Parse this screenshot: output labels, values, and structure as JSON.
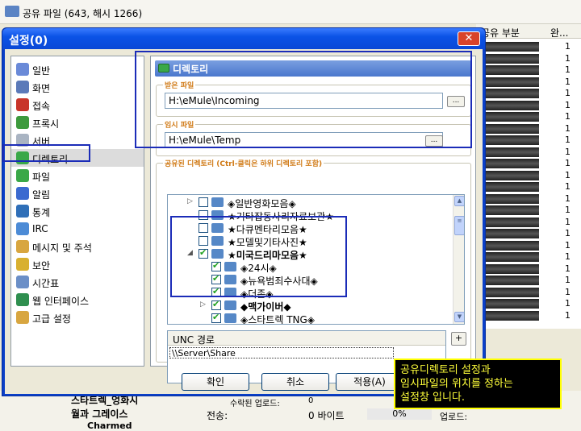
{
  "app": {
    "title": "공유 파일 (643, 해시 1266)",
    "columns": [
      "공유 부분",
      "완..."
    ],
    "list_values": [
      "1",
      "1",
      "1",
      "1",
      "1",
      "1",
      "1",
      "1",
      "1",
      "1",
      "1",
      "1",
      "1",
      "1",
      "1",
      "1",
      "1",
      "1",
      "1",
      "1",
      "1",
      "1",
      "1",
      "1"
    ],
    "bottom_tree": [
      "스타트렉_엉화시",
      "월과 그레이스",
      "Charmed"
    ],
    "stats": {
      "uploaded_label": "수락된 업로드:",
      "uploaded_value": "0",
      "transfer_label": "전송:",
      "transfer_value": "0 바이트",
      "percent": "0%",
      "upload_label": "업로드:"
    }
  },
  "dialog": {
    "title": "설정(0)",
    "close_label": "✕",
    "nav": [
      {
        "label": "일반",
        "icon": "general-icon",
        "color": "#6a8ad8"
      },
      {
        "label": "화면",
        "icon": "display-icon",
        "color": "#5b7ab9"
      },
      {
        "label": "접속",
        "icon": "connection-icon",
        "color": "#c8352a"
      },
      {
        "label": "프록시",
        "icon": "proxy-icon",
        "color": "#3d9a3d"
      },
      {
        "label": "서버",
        "icon": "server-icon",
        "color": "#a9b4c2"
      },
      {
        "label": "디렉토리",
        "icon": "directory-icon",
        "color": "#3aa848"
      },
      {
        "label": "파일",
        "icon": "file-icon",
        "color": "#3aa848"
      },
      {
        "label": "알림",
        "icon": "notification-icon",
        "color": "#3b6ad0"
      },
      {
        "label": "통계",
        "icon": "statistics-icon",
        "color": "#2f6fb8"
      },
      {
        "label": "IRC",
        "icon": "irc-icon",
        "color": "#4c8bd6"
      },
      {
        "label": "메시지 및 주석",
        "icon": "messages-icon",
        "color": "#d8a640"
      },
      {
        "label": "보안",
        "icon": "security-icon",
        "color": "#d8b030"
      },
      {
        "label": "시간표",
        "icon": "scheduler-icon",
        "color": "#6b8fc7"
      },
      {
        "label": "웹 인터페이스",
        "icon": "web-interface-icon",
        "color": "#2f8f4f"
      },
      {
        "label": "고급 설정",
        "icon": "advanced-icon",
        "color": "#d8a640"
      }
    ],
    "selected_index": 5,
    "panel_title": "디렉토리",
    "incoming_label": "받은 파일",
    "incoming_path": "H:\\eMule\\Incoming",
    "temp_label": "임시 파일",
    "temp_path": "H:\\eMule\\Temp",
    "browse_label": "...",
    "shared_label": "공유된 디렉토리 (Ctrl-클릭은 하위 디렉토리 포함)",
    "tree": [
      {
        "label": "◈일반영화모음◈",
        "checked": false,
        "expander": "▷",
        "bold": false
      },
      {
        "label": "★기타잡동사리자료보관★",
        "checked": false,
        "expander": "",
        "bold": false
      },
      {
        "label": "★다큐멘타리모음★",
        "checked": false,
        "expander": "",
        "bold": false
      },
      {
        "label": "★모델및기타사진★",
        "checked": false,
        "expander": "",
        "bold": false
      },
      {
        "label": "★미국드리마모음★",
        "checked": true,
        "expander": "◢",
        "bold": true
      },
      {
        "label": "◈24시◈",
        "checked": true,
        "expander": "",
        "bold": false
      },
      {
        "label": "◈뉴욕범죄수사대◈",
        "checked": true,
        "expander": "",
        "bold": false
      },
      {
        "label": "◈더존◈",
        "checked": true,
        "expander": "",
        "bold": false
      },
      {
        "label": "◆맥가이버◆",
        "checked": true,
        "expander": "▷",
        "bold": true
      },
      {
        "label": "◈스타트렉 TNG◈",
        "checked": true,
        "expander": "",
        "bold": false
      }
    ],
    "unc_header": "UNC 경로",
    "unc_value": "\\\\Server\\Share",
    "add_label": "+",
    "remove_label": "−",
    "ok_label": "확인",
    "cancel_label": "취소",
    "apply_label": "적용(A)"
  },
  "annotation": {
    "line1": "공유디렉토리 설정과",
    "line2": "임시파일의 위치를 정하는",
    "line3": "설정창 입니다."
  }
}
